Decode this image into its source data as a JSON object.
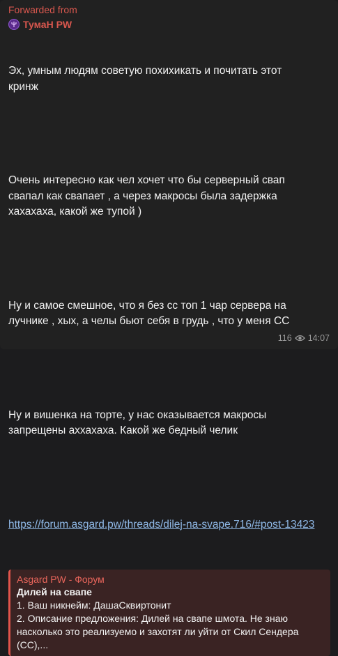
{
  "message": {
    "forwarded_label": "Forwarded from",
    "channel_name": "ТумаН PW",
    "paragraphs": [
      "Эх, умным людям советую похихикать и почитать этот\nкринж",
      "Очень интересно как чел хочет что бы серверный свап\nсвапал как свапает , а через макросы была задержка\nхахахаха, какой же тупой )",
      "Ну и самое смешное, что я без сс топ 1 чар сервера на\nлучнике , хых, а челы бьют себя в грудь , что у меня СС",
      "Ну и вишенка на торте, у нас оказывается макросы\nзапрещены аххахаха. Какой же бедный челик"
    ],
    "link": "https://forum.asgard.pw/threads/dilej-na-svape.716/#post-13423",
    "preview": {
      "site": "Asgard PW - Форум",
      "title": "Дилей на свапе",
      "description": "1. Ваш никнейм: ДашаСквиртонит\n2. Описание предложения: Дилей на свапе шмота. Не знаю\nнасколько это реализуемо и захотят ли уйти от Скил Сендера\n(СС),..."
    },
    "views": "116",
    "time": "14:07"
  },
  "colors": {
    "accent": "#d8574e",
    "link": "#8fb8e6",
    "preview_bg": "#3a2323"
  }
}
